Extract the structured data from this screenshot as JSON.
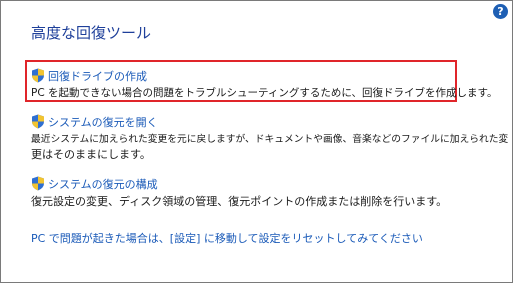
{
  "page_title": "高度な回復ツール",
  "help_icon": {
    "glyph": "?",
    "icon": "help-icon",
    "color": "#1e5fb4"
  },
  "highlight_color": "#e0252a",
  "items": [
    {
      "icon": "uac-shield-icon",
      "link": "回復ドライブの作成",
      "description_lines": [
        "PC を起動できない場合の問題をトラブルシューティングするために、回復ドライブを作成します。"
      ]
    },
    {
      "icon": "uac-shield-icon",
      "link": "システムの復元を開く",
      "description_lines": [
        "最近システムに加えられた変更を元に戻しますが、ドキュメントや画像、音楽などのファイルに加えられた変",
        "更はそのままにします。"
      ]
    },
    {
      "icon": "uac-shield-icon",
      "link": "システムの復元の構成",
      "description_lines": [
        "復元設定の変更、ディスク領域の管理、復元ポイントの作成または削除を行います。"
      ]
    }
  ],
  "bottom_link": "PC で問題が起きた場合は、[設定] に移動して設定をリセットしてみてください"
}
